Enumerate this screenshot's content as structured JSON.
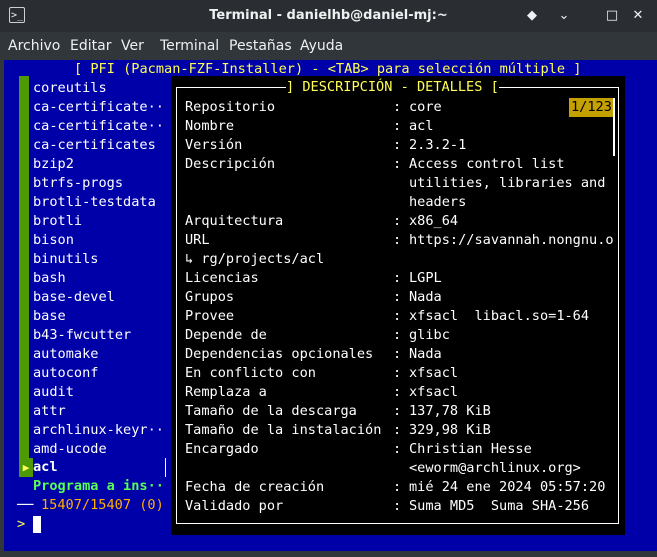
{
  "window": {
    "title": "Terminal - danielhb@daniel-mj:~",
    "icon": "terminal-icon",
    "app_icon_glyph": ">_"
  },
  "window_buttons": {
    "diamond": "◆",
    "minimize": "⌄",
    "maximize": "□",
    "close": "✕"
  },
  "menu": [
    "Archivo",
    "Editar",
    "Ver",
    "Terminal",
    "Pestañas",
    "Ayuda"
  ],
  "header": "[ PFI (Pacman-FZF-Installer) - <TAB> para selección múltiple ]",
  "list": [
    "coreutils",
    "ca-certificate··",
    "ca-certificate··",
    "ca-certificates",
    "bzip2",
    "btrfs-progs",
    "brotli-testdata",
    "brotli",
    "bison",
    "binutils",
    "bash",
    "base-devel",
    "base",
    "b43-fwcutter",
    "automake",
    "autoconf",
    "audit",
    "attr",
    "archlinux-keyr··",
    "amd-ucode"
  ],
  "selected": {
    "marker": "▶",
    "name": "acl"
  },
  "status_line": "Programa a ins··",
  "counter": {
    "prefix": "──",
    "text": "15407/15407 (0)"
  },
  "prompt": {
    "symbol": ">",
    "query": ""
  },
  "preview": {
    "title": "] DESCRIPCIÓN - DETALLES [",
    "position": "1/123",
    "sep": ":",
    "rows": [
      {
        "label": "Repositorio",
        "value": "core"
      },
      {
        "label": "Nombre",
        "value": "acl"
      },
      {
        "label": "Versión",
        "value": "2.3.2-1"
      },
      {
        "label": "Descripción",
        "value": "Access control list"
      },
      {
        "label": "",
        "value": "utilities, libraries and"
      },
      {
        "label": "",
        "value": "headers"
      },
      {
        "label": "Arquitectura",
        "value": "x86_64"
      },
      {
        "label": "URL",
        "value": "https://savannah.nongnu.o"
      },
      {
        "label": "↳ rg/projects/acl",
        "value": ""
      },
      {
        "label": "Licencias",
        "value": "LGPL"
      },
      {
        "label": "Grupos",
        "value": "Nada"
      },
      {
        "label": "Provee",
        "value": "xfsacl  libacl.so=1-64"
      },
      {
        "label": "Depende de",
        "value": "glibc"
      },
      {
        "label": "Dependencias opcionales",
        "value": "Nada"
      },
      {
        "label": "En conflicto con",
        "value": "xfsacl"
      },
      {
        "label": "Remplaza a",
        "value": "xfsacl"
      },
      {
        "label": "Tamaño de la descarga",
        "value": "137,78 KiB"
      },
      {
        "label": "Tamaño de la instalación",
        "value": "329,98 KiB"
      },
      {
        "label": "Encargado",
        "value": "Christian Hesse"
      },
      {
        "label": "",
        "value": "<eworm@archlinux.org>"
      },
      {
        "label": "Fecha de creación",
        "value": "mié 24 ene 2024 05:57:20"
      },
      {
        "label": "Validado por",
        "value": "Suma MD5  Suma SHA-256"
      }
    ]
  }
}
